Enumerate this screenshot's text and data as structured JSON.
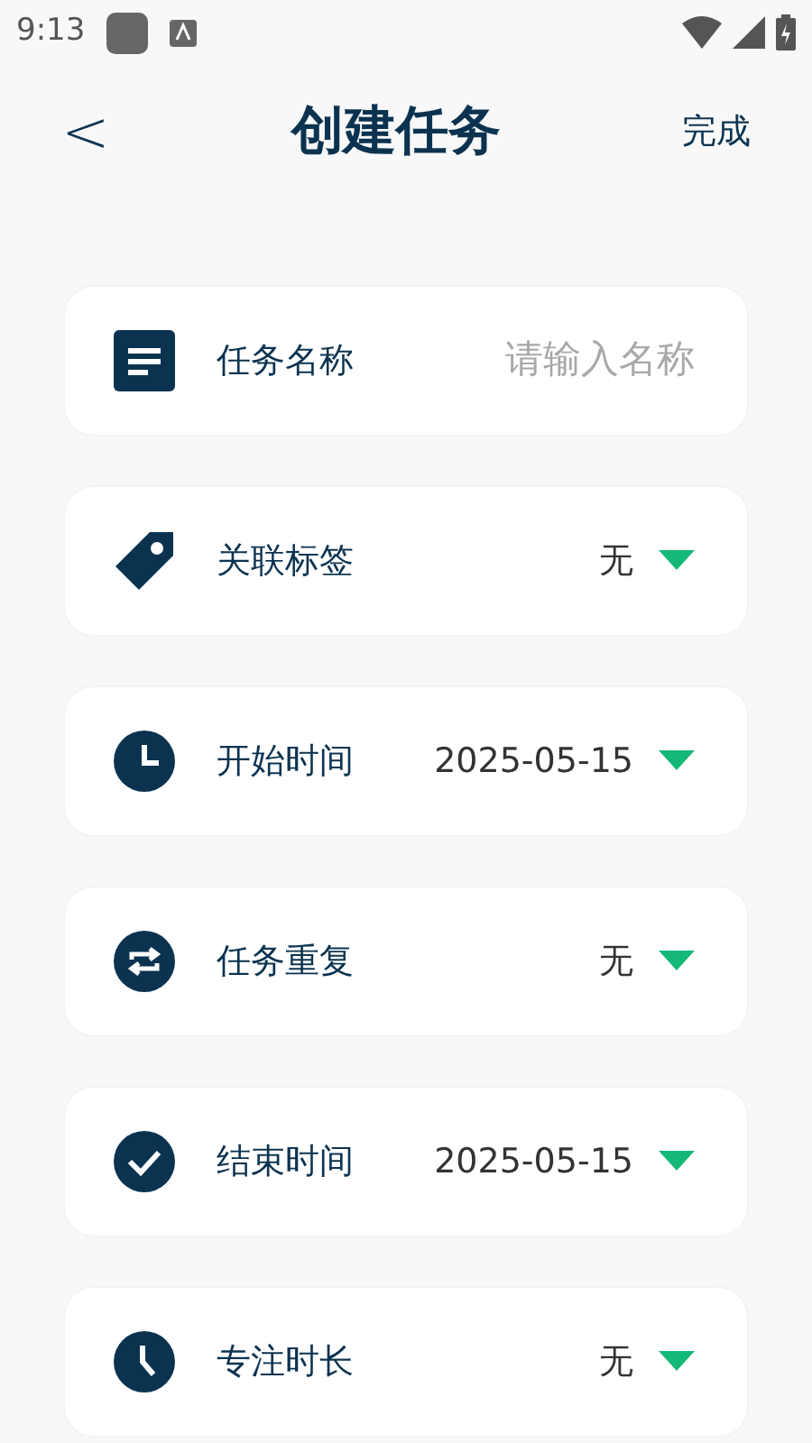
{
  "status_bar": {
    "time": "9:13"
  },
  "header": {
    "back": "<",
    "title": "创建任务",
    "action": "完成"
  },
  "rows": [
    {
      "kind": "input",
      "label": "任务名称",
      "placeholder": "请输入名称"
    },
    {
      "kind": "select",
      "label": "关联标签",
      "value": "无"
    },
    {
      "kind": "select",
      "label": "开始时间",
      "value": "2025-05-15"
    },
    {
      "kind": "select",
      "label": "任务重复",
      "value": "无"
    },
    {
      "kind": "select",
      "label": "结束时间",
      "value": "2025-05-15"
    },
    {
      "kind": "select",
      "label": "专注时长",
      "value": "无"
    }
  ]
}
